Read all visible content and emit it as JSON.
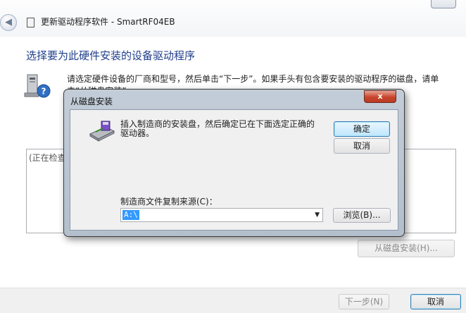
{
  "window": {
    "title": "更新驱动程序软件 - SmartRF04EB",
    "back_glyph": "◀"
  },
  "main": {
    "heading": "选择要为此硬件安装的设备驱动程序",
    "instruction": "请选定硬件设备的厂商和型号，然后单击“下一步”。如果手头有包含要安装的驱动程序的磁盘，请单击“从磁盘安装”。",
    "list_status": "(正在检查...)",
    "have_disk_button": "从磁盘安装(H)..."
  },
  "footer": {
    "next_button": "下一步(N)",
    "cancel_button": "取消"
  },
  "dialog": {
    "title": "从磁盘安装",
    "close_glyph": "x",
    "message": "插入制造商的安装盘，然后确定已在下面选定正确的驱动器。",
    "ok_button": "确定",
    "cancel_button": "取消",
    "source_label": "制造商文件复制来源(C)：",
    "source_value": "A:\\",
    "browse_button": "浏览(B)..."
  },
  "colors": {
    "heading": "#1f3e8c",
    "selection": "#3399ff",
    "dialog_frame": "#b3bfcd",
    "close_button": "#c8452c"
  },
  "icons": [
    "back-arrow-icon",
    "hardware-help-icon",
    "floppy-disk-icon",
    "close-icon",
    "dropdown-arrow-icon"
  ]
}
